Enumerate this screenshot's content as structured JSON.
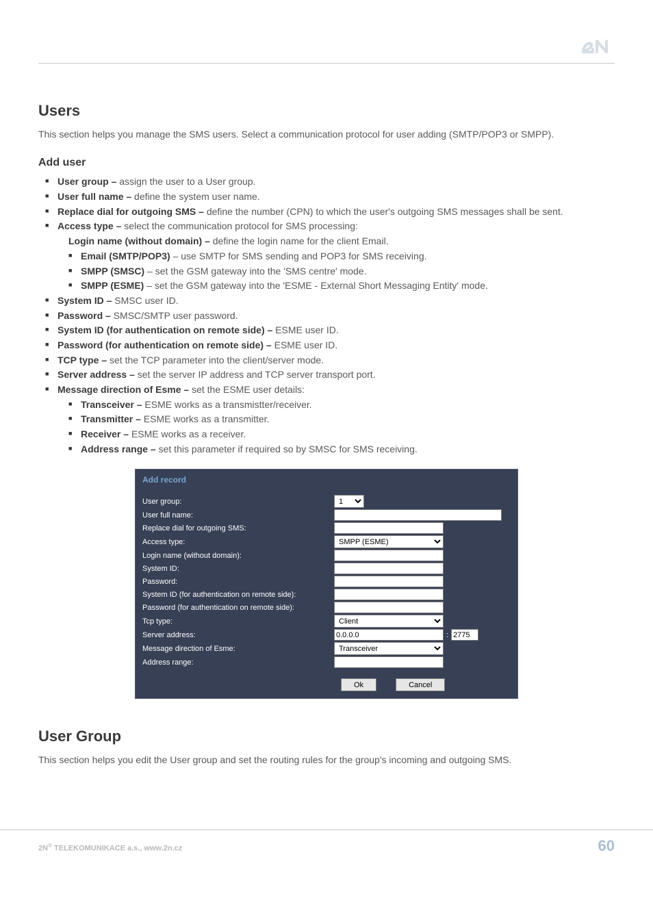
{
  "logo": {
    "alt": "2N"
  },
  "sections": {
    "users": {
      "title": "Users",
      "intro": "This section helps you manage the SMS users. Select a communication protocol for user adding (SMTP/POP3 or SMPP)."
    },
    "add_user": {
      "title": "Add user",
      "items": {
        "user_group": {
          "label": "User group – ",
          "desc": "assign the user to a User group."
        },
        "user_full_name": {
          "label": "User full name – ",
          "desc": "define the system user name."
        },
        "replace_dial": {
          "label": "Replace dial for outgoing SMS – ",
          "desc": "define the number (CPN) to which the user's outgoing SMS messages shall be sent."
        },
        "access_type": {
          "label": "Access type – ",
          "desc": "select the communication protocol for SMS processing:",
          "login_line": {
            "label": "Login name (without domain) – ",
            "desc": "  define the login name for the client Email."
          },
          "sub": {
            "email": {
              "label": "Email (SMTP/POP3)",
              "desc": " – use SMTP for SMS sending and POP3 for SMS receiving."
            },
            "smpp_smsc": {
              "label": "SMPP (SMSC)",
              "desc": " – set the GSM gateway into the 'SMS centre' mode."
            },
            "smpp_esme": {
              "label": "SMPP (ESME)",
              "desc": " – set the GSM gateway into the 'ESME - External Short Messaging Entity' mode."
            }
          }
        },
        "system_id": {
          "label": "System ID – ",
          "desc": "SMSC user ID."
        },
        "password": {
          "label": "Password – ",
          "desc": "SMSC/SMTP user password."
        },
        "system_id_remote": {
          "label": "System ID (for authentication on remote side) – ",
          "desc": "ESME user ID."
        },
        "password_remote": {
          "label": "Password (for authentication on remote side) – ",
          "desc": "ESME user ID."
        },
        "tcp_type": {
          "label": "TCP type – ",
          "desc": "set the TCP parameter into the client/server mode."
        },
        "server_address": {
          "label": "Server address – ",
          "desc": "  set the server IP address and TCP server transport port."
        },
        "msg_direction": {
          "label": "Message direction of Esme – ",
          "desc": "set the ESME user details:",
          "sub": {
            "transceiver": {
              "label": "Transceiver – ",
              "desc": "ESME works as a transmistter/receiver."
            },
            "transmitter": {
              "label": "Transmitter – ",
              "desc": "ESME works as a transmitter."
            },
            "receiver": {
              "label": "Receiver – ",
              "desc": "ESME works as a receiver."
            },
            "address_range": {
              "label": "Address range – ",
              "desc": "set this parameter if required so by SMSC for SMS receiving."
            }
          }
        }
      }
    },
    "user_group": {
      "title": "User Group",
      "intro": "This section helps you edit the User group and set the routing rules for the group's incoming and outgoing SMS."
    }
  },
  "panel": {
    "title": "Add record",
    "labels": {
      "user_group": "User group:",
      "user_full_name": "User full name:",
      "replace_dial": "Replace dial for outgoing SMS:",
      "access_type": "Access type:",
      "login_name": "Login name (without domain):",
      "system_id": "System ID:",
      "password": "Password:",
      "system_id_remote": "System ID (for authentication on remote side):",
      "password_remote": "Password (for authentication on remote side):",
      "tcp_type": "Tcp type:",
      "server_address": "Server address:",
      "msg_direction": "Message direction of Esme:",
      "address_range": "Address range:"
    },
    "values": {
      "user_group": "1",
      "access_type": "SMPP (ESME)",
      "tcp_type": "Client",
      "server_ip": "0.0.0.0",
      "server_port_sep": ":",
      "server_port": "2775",
      "msg_direction": "Transceiver"
    },
    "buttons": {
      "ok": "Ok",
      "cancel": "Cancel"
    }
  },
  "footer": {
    "left_prefix": "2N",
    "left_sup": "®",
    "left_rest": " TELEKOMUNIKACE a.s., www.2n.cz",
    "page": "60"
  }
}
